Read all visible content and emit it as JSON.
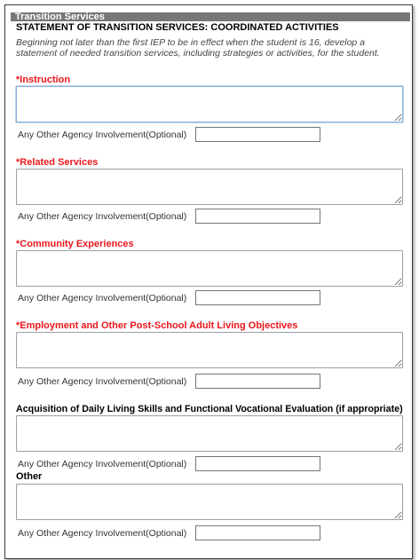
{
  "header": {
    "title": "Transition Services"
  },
  "section": {
    "title": "STATEMENT OF TRANSITION SERVICES: COORDINATED ACTIVITIES",
    "intro": "Beginning not later than the first IEP to be in effect when the student is 16, develop a statement of needed transition services, including strategies or activities, for the student."
  },
  "fields": [
    {
      "required_mark": "*",
      "label": "Instruction",
      "value": ""
    },
    {
      "required_mark": "*",
      "label": "Related Services",
      "value": ""
    },
    {
      "required_mark": "*",
      "label": "Community Experiences",
      "value": ""
    },
    {
      "required_mark": "*",
      "label": "Employment and Other Post-School Adult Living Objectives",
      "value": ""
    },
    {
      "required_mark": "",
      "label": "Acquisition of Daily Living Skills and Functional Vocational Evaluation (if appropriate)",
      "value": ""
    },
    {
      "required_mark": "",
      "label": "Other",
      "value": ""
    }
  ],
  "agency": {
    "label": "Any Other Agency Involvement(Optional)",
    "value": ""
  }
}
